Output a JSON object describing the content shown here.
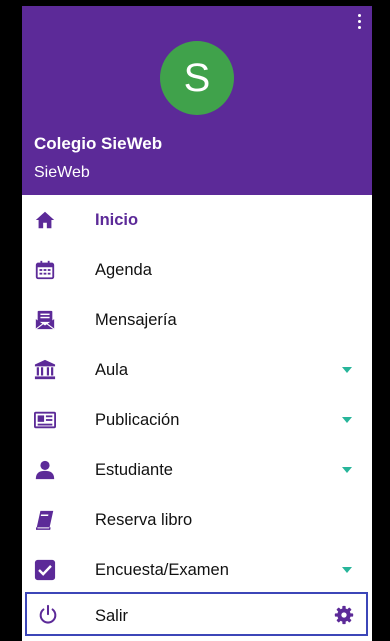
{
  "header": {
    "avatar_letter": "S",
    "school_name": "Colegio SieWeb",
    "subtitle": "SieWeb"
  },
  "menu": {
    "items": [
      {
        "label": "Inicio",
        "icon": "home-icon",
        "active": true,
        "expandable": false
      },
      {
        "label": "Agenda",
        "icon": "calendar-icon",
        "active": false,
        "expandable": false
      },
      {
        "label": "Mensajería",
        "icon": "mail-icon",
        "active": false,
        "expandable": false
      },
      {
        "label": "Aula",
        "icon": "classroom-icon",
        "active": false,
        "expandable": true
      },
      {
        "label": "Publicación",
        "icon": "newspaper-icon",
        "active": false,
        "expandable": true
      },
      {
        "label": "Estudiante",
        "icon": "student-icon",
        "active": false,
        "expandable": true
      },
      {
        "label": "Reserva libro",
        "icon": "book-icon",
        "active": false,
        "expandable": false
      },
      {
        "label": "Encuesta/Examen",
        "icon": "checkbox-icon",
        "active": false,
        "expandable": true
      }
    ]
  },
  "footer": {
    "logout_label": "Salir",
    "logout_icon": "power-icon",
    "settings_icon": "gear-icon"
  },
  "colors": {
    "brand": "#5c2a98",
    "avatar": "#40a24b",
    "caret": "#27b59a",
    "focus_border": "#3c46b8"
  }
}
